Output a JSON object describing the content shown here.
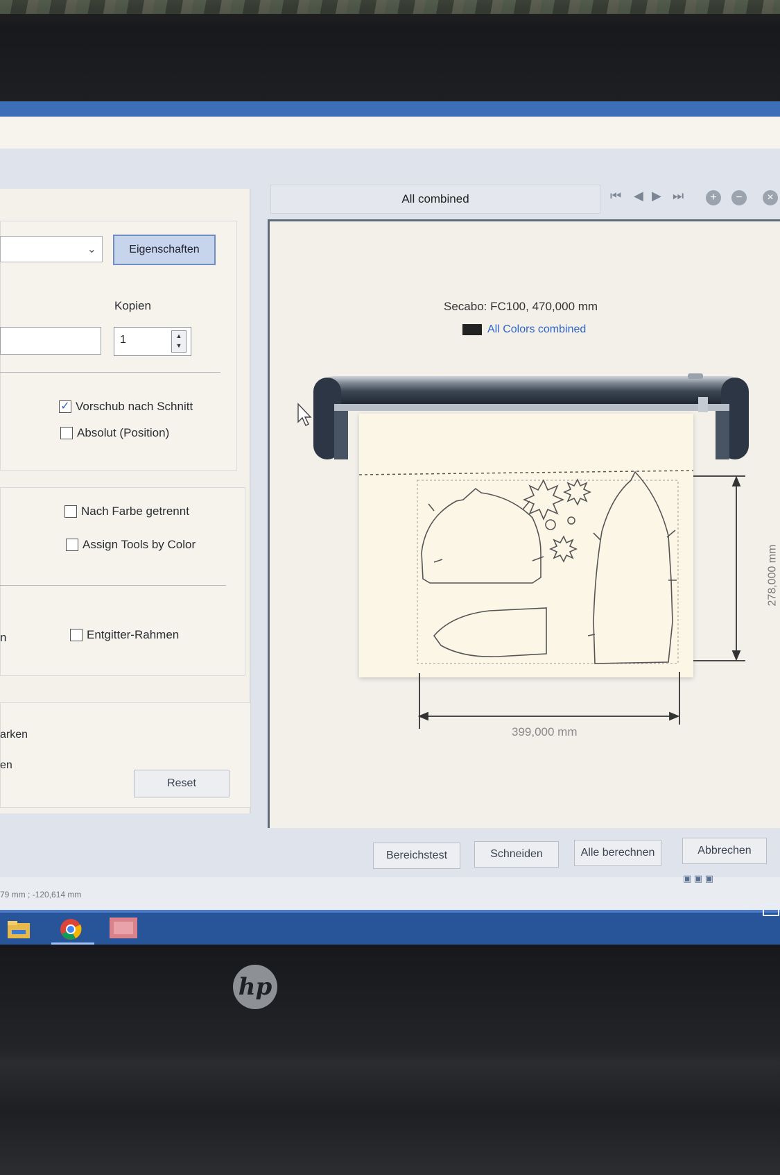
{
  "preview": {
    "header": "All combined",
    "device_info": "Secabo: FC100,  470,000 mm",
    "legend_label": "All Colors combined",
    "legend_color": "#222222",
    "width_dim": "399,000 mm",
    "height_dim": "278,000 mm"
  },
  "left": {
    "properties_button": "Eigenschaften",
    "copies_label": "Kopien",
    "copies_value": "1",
    "checkbox_feed": "Vorschub nach Schnitt",
    "checkbox_absolute": "Absolut (Position)",
    "checkbox_by_color": "Nach Farbe getrennt",
    "checkbox_assign_tools": "Assign Tools by Color",
    "checkbox_weed_frame": "Entgitter-Rahmen",
    "partial_label_1": "n",
    "partial_label_2": "arken",
    "partial_label_3": "en",
    "reset_button": "Reset"
  },
  "checkbox_states": {
    "feed": true,
    "absolute": false,
    "by_color": false,
    "assign_tools": false,
    "weed_frame": false
  },
  "footer": {
    "test_button": "Bereichstest",
    "cut_button": "Schneiden",
    "calc_button": "Alle berechnen",
    "cancel_button": "Abbrechen",
    "status_coords": "79 mm ; -120,614 mm"
  },
  "nav_icons": [
    "first-page-icon",
    "prev-page-icon",
    "next-page-icon",
    "last-page-icon"
  ],
  "zoom_icons": [
    "zoom-in-icon",
    "zoom-out-icon",
    "zoom-fit-icon"
  ],
  "taskbar": {
    "apps": [
      "file-explorer-icon",
      "chrome-icon",
      "cutting-app-icon"
    ]
  },
  "bezel": {
    "logo": "hp"
  }
}
